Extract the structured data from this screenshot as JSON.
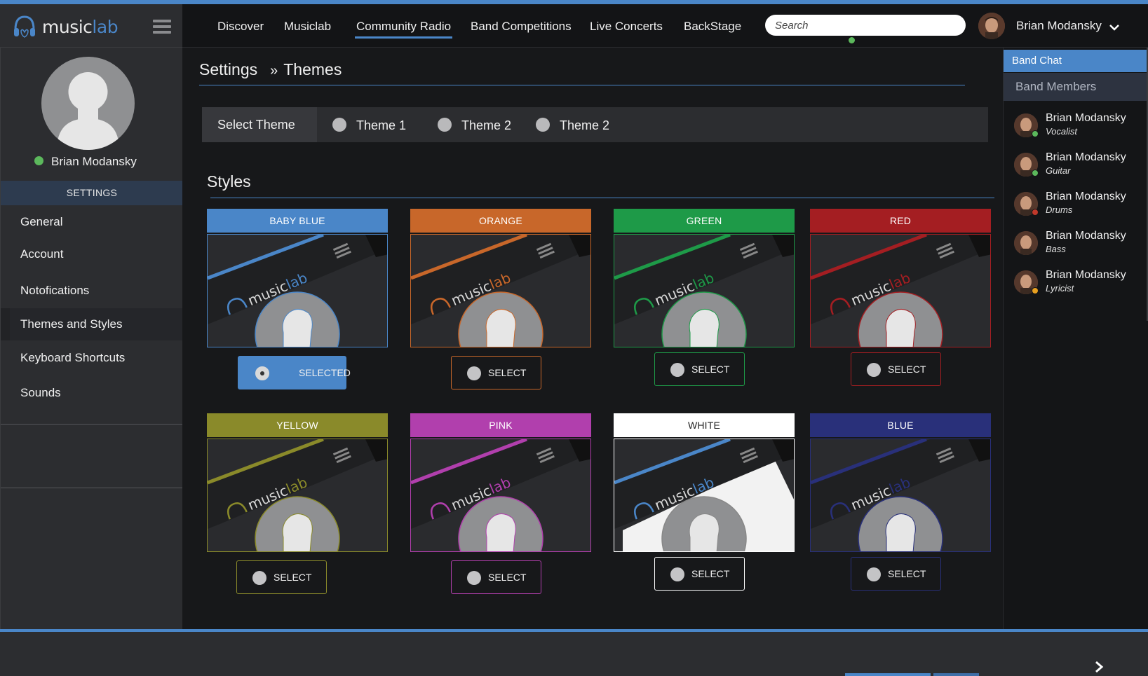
{
  "header": {
    "logo_text_main": "music",
    "logo_text_accent": "lab",
    "nav": [
      "Discover",
      "Musiclab",
      "Community Radio",
      "Band Competitions",
      "Live Concerts",
      "BackStage"
    ],
    "active_nav": "Community Radio",
    "search_placeholder": "Search",
    "user_name": "Brian Modansky"
  },
  "sidebar": {
    "profile_name": "Brian Modansky",
    "status": "online",
    "section_title": "SETTINGS",
    "items": [
      "General",
      "Account",
      "Notofications",
      "Themes and Styles",
      "Keyboard Shortcuts",
      "Sounds"
    ],
    "active_item": "Themes and Styles"
  },
  "main": {
    "breadcrumb": {
      "root": "Settings",
      "separator": "»",
      "current": "Themes"
    },
    "select_theme_label": "Select Theme",
    "theme_options": [
      "Theme 1",
      "Theme 2",
      "Theme 2"
    ],
    "styles_title": "Styles",
    "styles": [
      {
        "name": "BABY BLUE",
        "color": "#4a86c8",
        "button": "SELECTED",
        "selected": true
      },
      {
        "name": "ORANGE",
        "color": "#c8672a",
        "button": "SELECT",
        "selected": false
      },
      {
        "name": "GREEN",
        "color": "#1e9a48",
        "button": "SELECT",
        "selected": false
      },
      {
        "name": "RED",
        "color": "#a41e22",
        "button": "SELECT",
        "selected": false
      },
      {
        "name": "YELLOW",
        "color": "#8a8a2a",
        "button": "SELECT",
        "selected": false
      },
      {
        "name": "PINK",
        "color": "#b13fad",
        "button": "SELECT",
        "selected": false
      },
      {
        "name": "WHITE",
        "color": "#ffffff",
        "button": "SELECT",
        "selected": false
      },
      {
        "name": "BLUE",
        "color": "#29307a",
        "button": "SELECT",
        "selected": false
      }
    ]
  },
  "right_panel": {
    "band_chat": "Band Chat",
    "band_members_title": "Band Members",
    "members": [
      {
        "name": "Brian Modansky",
        "role": "Vocalist",
        "status_color": "#5cb85c"
      },
      {
        "name": "Brian Modansky",
        "role": "Guitar",
        "status_color": "#5cb85c"
      },
      {
        "name": "Brian Modansky",
        "role": "Drums",
        "status_color": "#c0392b"
      },
      {
        "name": "Brian Modansky",
        "role": "Bass",
        "status_color": ""
      },
      {
        "name": "Brian Modansky",
        "role": "Lyricist",
        "status_color": "#e8a020"
      }
    ]
  },
  "icons": [
    "headphones-logo-icon",
    "hamburger-menu-icon",
    "chevron-down-icon",
    "default-avatar-icon",
    "chevron-right-icon"
  ]
}
